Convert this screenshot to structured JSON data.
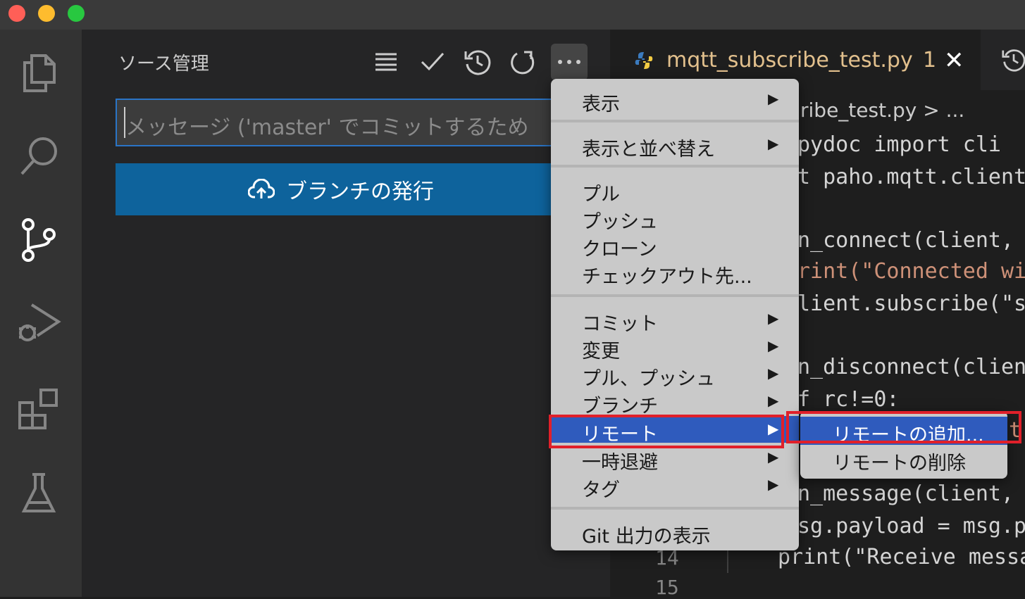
{
  "window": {
    "traffic_colors": [
      "#ff5f57",
      "#febc2e",
      "#28c840"
    ]
  },
  "activity_bar": {
    "items": [
      "files-icon",
      "search-icon",
      "source-control-icon",
      "run-debug-icon",
      "extensions-icon",
      "testing-icon"
    ]
  },
  "sidebar": {
    "title": "ソース管理",
    "commit_placeholder": "メッセージ ('master' でコミットするため",
    "publish_button": "ブランチの発行"
  },
  "editor": {
    "tab_name": "mqtt_subscribe_test.py",
    "tab_problems": "1",
    "breadcrumb": "ribe_test.py > ...",
    "lines": [
      {
        "text": "pydoc import cli"
      },
      {
        "text": "t paho.mqtt.client"
      },
      {
        "text": "n_connect(client, u"
      },
      {
        "text": "rint(\"Connected wit"
      },
      {
        "text": "lient.subscribe(\"se"
      },
      {
        "text": "n_disconnect(client"
      },
      {
        "text": "f rc!=0:"
      },
      {
        "text": "t"
      },
      {
        "text": "n_message(client, u"
      },
      {
        "text": "sg.payload = msg.pa"
      },
      {
        "text": "print(\"Receive messa"
      }
    ],
    "line_numbers": [
      "14",
      "15"
    ]
  },
  "menu": {
    "items": [
      {
        "label": "表示",
        "submenu": true
      },
      {
        "label": "表示と並べ替え",
        "submenu": true
      },
      {
        "label": "プル",
        "submenu": false
      },
      {
        "label": "プッシュ",
        "submenu": false
      },
      {
        "label": "クローン",
        "submenu": false
      },
      {
        "label": "チェックアウト先...",
        "submenu": false
      },
      {
        "label": "コミット",
        "submenu": true
      },
      {
        "label": "変更",
        "submenu": true
      },
      {
        "label": "プル、プッシュ",
        "submenu": true
      },
      {
        "label": "ブランチ",
        "submenu": true
      },
      {
        "label": "リモート",
        "submenu": true,
        "selected": true
      },
      {
        "label": "一時退避",
        "submenu": true
      },
      {
        "label": "タグ",
        "submenu": true
      },
      {
        "label": "Git 出力の表示",
        "submenu": false
      }
    ]
  },
  "submenu": {
    "items": [
      {
        "label": "リモートの追加...",
        "selected": true
      },
      {
        "label": "リモートの削除",
        "selected": false
      }
    ]
  },
  "arrow_glyph": "▶",
  "colors": {
    "accent": "#0e639c",
    "menu_highlight": "#2f5bbd",
    "annotation": "#e0202a",
    "modified_file": "#e2c08d"
  }
}
